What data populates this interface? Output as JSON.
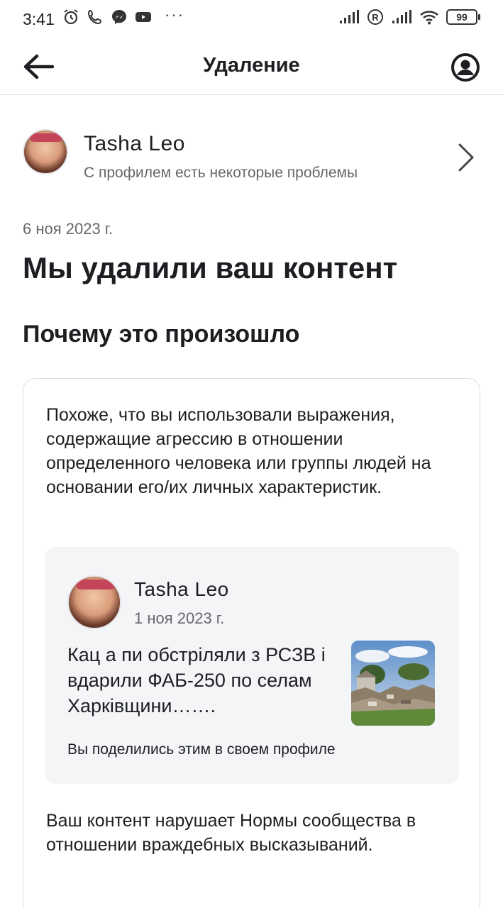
{
  "status_bar": {
    "time": "3:41",
    "dots": "···",
    "battery": "99",
    "left_icons": [
      "alarm-icon",
      "phone-icon",
      "messenger-icon",
      "youtube-icon"
    ],
    "right_icons": [
      "signal-icon",
      "registered-icon",
      "signal-icon",
      "wifi-icon",
      "battery-icon"
    ]
  },
  "app_bar": {
    "title": "Удаление",
    "back_icon": "arrow-left-icon",
    "profile_icon": "account-circle-icon"
  },
  "profile": {
    "name": "Tasha  Leo",
    "status": "С профилем есть некоторые проблемы",
    "chevron_icon": "chevron-right-icon"
  },
  "content": {
    "date": "6 ноя 2023 г.",
    "title": "Мы удалили ваш контент",
    "section_title": "Почему это произошло",
    "reason": "Похоже, что вы использовали выражения, содержащие агрессию в отношении определенного человека или группы людей на основании его/их личных характеристик.",
    "post": {
      "author": "Tasha  Leo",
      "date": "1 ноя 2023 г.",
      "text": "Кац а пи обстріляли з РСЗВ і вдарили ФАБ-250 по селам Харківщини…….",
      "note": "Вы поделились этим в своем профиле"
    },
    "violation": "Ваш контент нарушает Нормы сообщества в отношении враждебных высказываний."
  },
  "colors": {
    "text_primary": "#1c1e21",
    "text_secondary": "#65676b",
    "divider": "#dadde1",
    "post_bg": "#f4f5f7"
  }
}
